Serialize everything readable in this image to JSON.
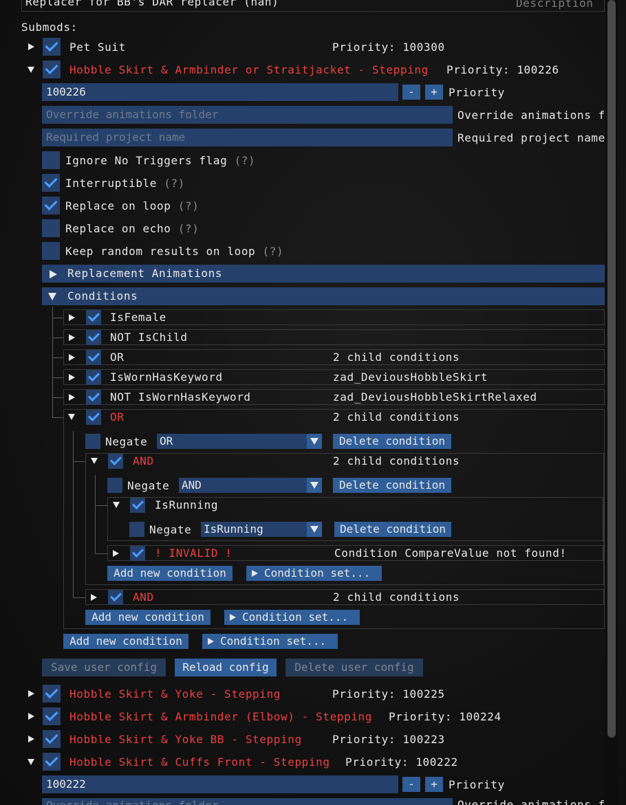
{
  "top": {
    "title": "Replacer for BB's DAR replacer (hah)",
    "description": "Description"
  },
  "submods_label": "Submods:",
  "submods_top": [
    {
      "name": "Pet Suit",
      "priority": "Priority: 100300",
      "checked": true
    }
  ],
  "expanded": {
    "name": "Hobble Skirt & Armbinder or Straitjacket - Stepping",
    "priority": "Priority: 100226",
    "priority_value": "100226",
    "minus": "-",
    "plus": "+",
    "priority_label": "Priority",
    "override_placeholder": "Override animations folder",
    "override_label": "Override animations f",
    "project_placeholder": "Required project name",
    "project_label": "Required project name",
    "options": [
      {
        "label": "Ignore No Triggers flag",
        "hint": "(?)",
        "checked": false
      },
      {
        "label": "Interruptible",
        "hint": "(?)",
        "checked": true
      },
      {
        "label": "Replace on loop",
        "hint": "(?)",
        "checked": true
      },
      {
        "label": "Replace on echo",
        "hint": "(?)",
        "checked": false
      },
      {
        "label": "Keep random results on loop",
        "hint": "(?)",
        "checked": false
      }
    ],
    "section_replacement": "Replacement Animations",
    "section_conditions": "Conditions",
    "conditions": [
      {
        "name": "IsFemale",
        "info": ""
      },
      {
        "name": "NOT IsChild",
        "info": ""
      },
      {
        "name": "OR",
        "info": "2 child conditions"
      },
      {
        "name": "IsWornHasKeyword",
        "info": "zad_DeviousHobbleSkirt"
      },
      {
        "name": "NOT IsWornHasKeyword",
        "info": "zad_DeviousHobbleSkirtRelaxed"
      }
    ],
    "or_group": {
      "name": "OR",
      "info": "2 child conditions",
      "negate": "Negate",
      "combo": "OR",
      "delete": "Delete condition",
      "and1": {
        "name": "AND",
        "info": "2 child conditions",
        "negate": "Negate",
        "combo": "AND",
        "delete": "Delete condition",
        "isrunning": {
          "name": "IsRunning",
          "negate": "Negate",
          "combo": "IsRunning",
          "delete": "Delete condition"
        },
        "invalid": {
          "name": "! INVALID !",
          "info": "Condition CompareValue not found!"
        },
        "add": "Add new condition",
        "set": "Condition set..."
      },
      "and2": {
        "name": "AND",
        "info": "2 child conditions"
      },
      "add": "Add new condition",
      "set": "Condition set..."
    },
    "add": "Add new condition",
    "set": "Condition set...",
    "save": "Save user config",
    "reload": "Reload config",
    "delete_cfg": "Delete user config"
  },
  "submods_bottom": [
    {
      "name": "Hobble Skirt & Yoke - Stepping",
      "priority": "Priority: 100225"
    },
    {
      "name": "Hobble Skirt & Armbinder (Elbow) - Stepping",
      "priority": "Priority: 100224"
    },
    {
      "name": "Hobble Skirt & Yoke BB - Stepping",
      "priority": "Priority: 100223"
    },
    {
      "name": "Hobble Skirt & Cuffs Front - Stepping",
      "priority": "Priority: 100222"
    }
  ],
  "last": {
    "priority_value": "100222",
    "minus": "-",
    "plus": "+",
    "priority_label": "Priority",
    "override_placeholder": "Override animations folder",
    "override_label": "Override animations f"
  }
}
